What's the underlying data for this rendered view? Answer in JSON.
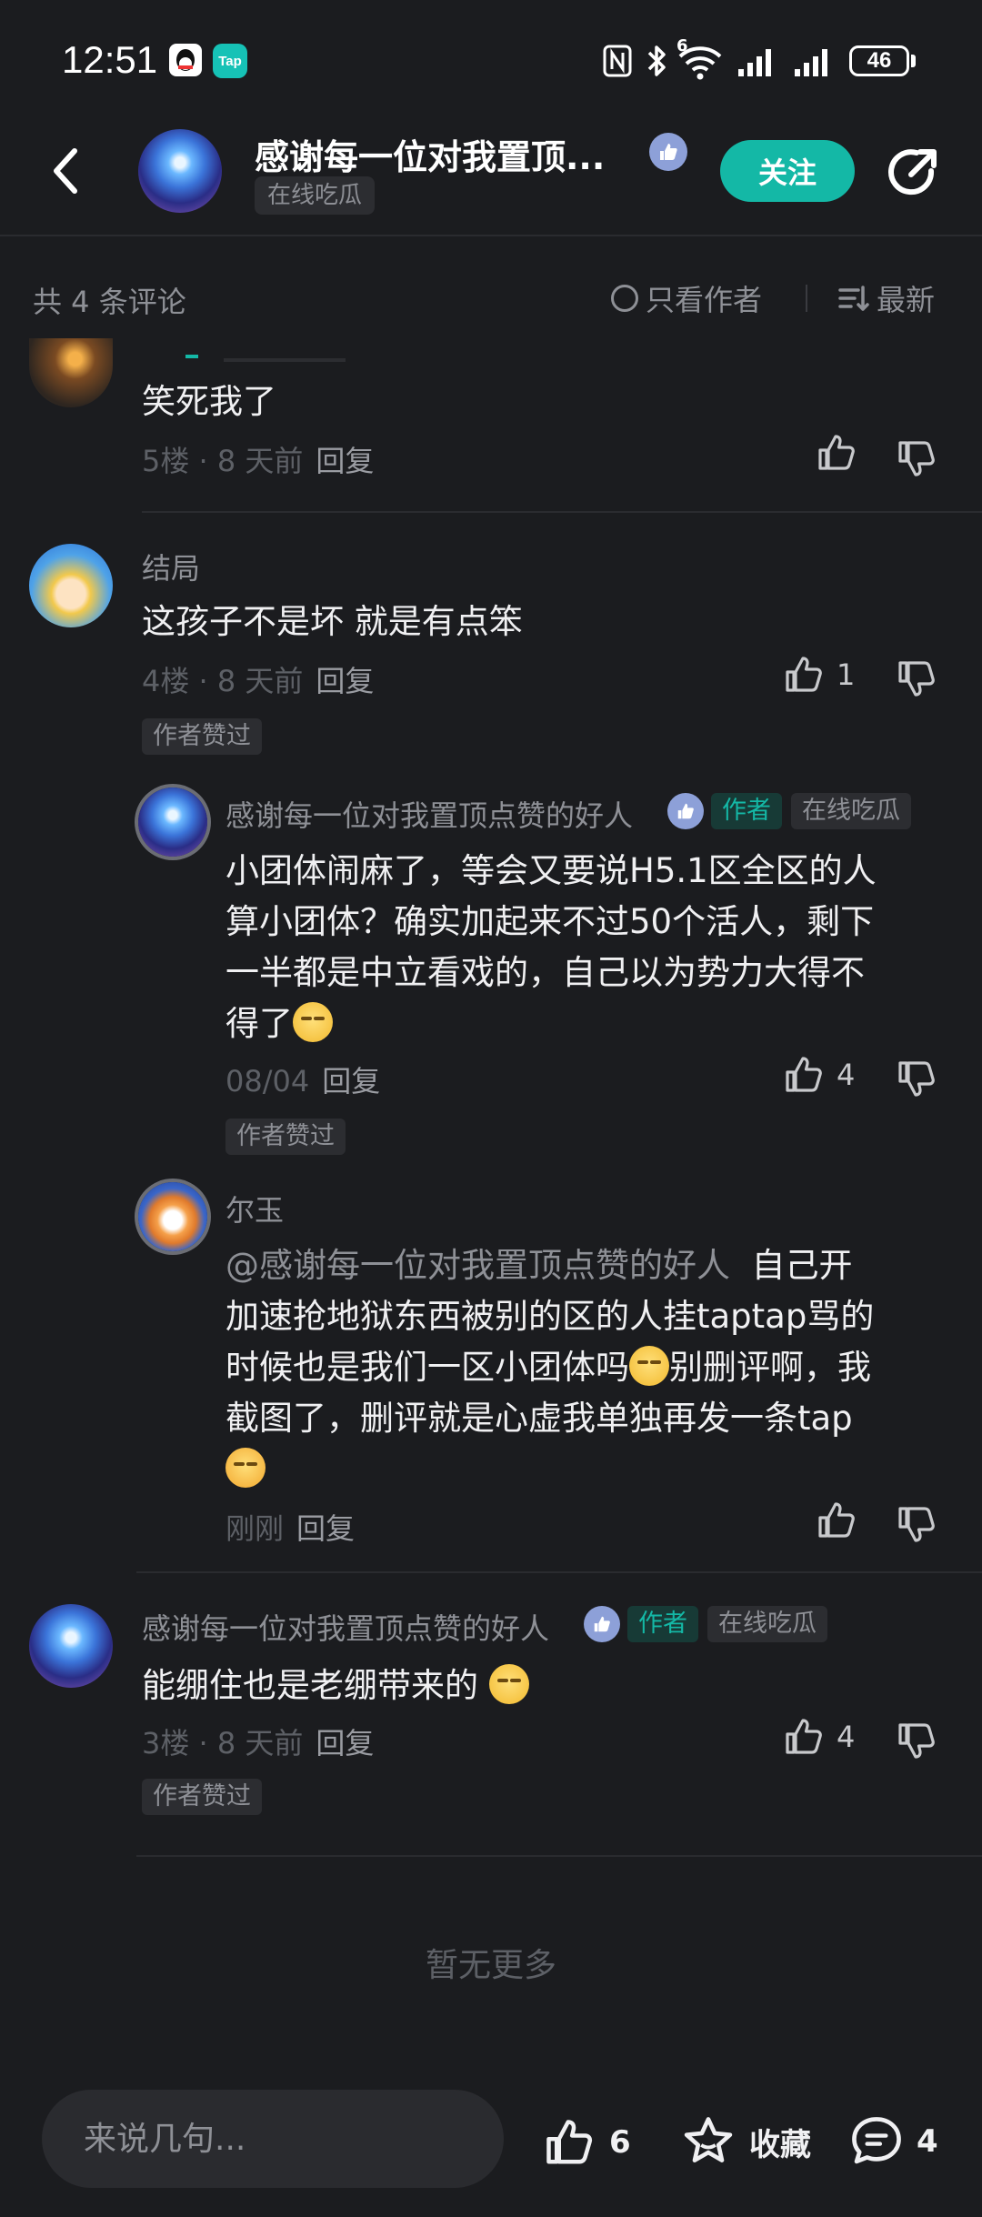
{
  "status_bar": {
    "time": "12:51",
    "app_badge": "Tap",
    "battery": "46",
    "network_label": "6"
  },
  "header": {
    "title": "感谢每一位对我置顶...",
    "tag": "在线吃瓜",
    "follow_label": "关注"
  },
  "filter": {
    "count_label": "共 4 条评论",
    "author_only_label": "只看作者",
    "sort_label": "最新"
  },
  "comments": [
    {
      "text": "笑死我了",
      "floor": "5楼 · 8 天前",
      "reply": "回复",
      "likes": ""
    },
    {
      "user": "结局",
      "text": "这孩子不是坏 就是有点笨",
      "floor": "4楼 · 8 天前",
      "reply": "回复",
      "likes": "1",
      "author_liked": "作者赞过",
      "replies": [
        {
          "user": "感谢每一位对我置顶点赞的好人",
          "author_tag": "作者",
          "tag": "在线吃瓜",
          "text_lines": [
            "小团体闹麻了，等会又要说H5.1区全区的人",
            "算小团体？确实加起来不过50个活人，剩下",
            "一半都是中立看戏的，自己以为势力大得不",
            "得了"
          ],
          "time": "08/04",
          "reply": "回复",
          "likes": "4",
          "author_liked": "作者赞过"
        },
        {
          "user": "尔玉",
          "mention": "@感谢每一位对我置顶点赞的好人",
          "text_lines": [
            "自己开",
            "加速抢地狱东西被别的区的人挂taptap骂的",
            "时候也是我们一区小团体吗",
            "别删评啊，我",
            "截图了，删评就是心虚我单独再发一条tap"
          ],
          "time": "刚刚",
          "reply": "回复"
        }
      ]
    },
    {
      "user": "感谢每一位对我置顶点赞的好人",
      "author_tag": "作者",
      "tag": "在线吃瓜",
      "text": "能绷住也是老绷带来的",
      "floor": "3楼 · 8 天前",
      "reply": "回复",
      "likes": "4",
      "author_liked": "作者赞过"
    }
  ],
  "no_more": "暂无更多",
  "bottom_bar": {
    "input_placeholder": "来说几句...",
    "like_count": "6",
    "favorite_label": "收藏",
    "comment_count": "4"
  },
  "colors": {
    "background": "#1b1c1f",
    "accent": "#14b8a6",
    "muted": "#8e9096"
  }
}
